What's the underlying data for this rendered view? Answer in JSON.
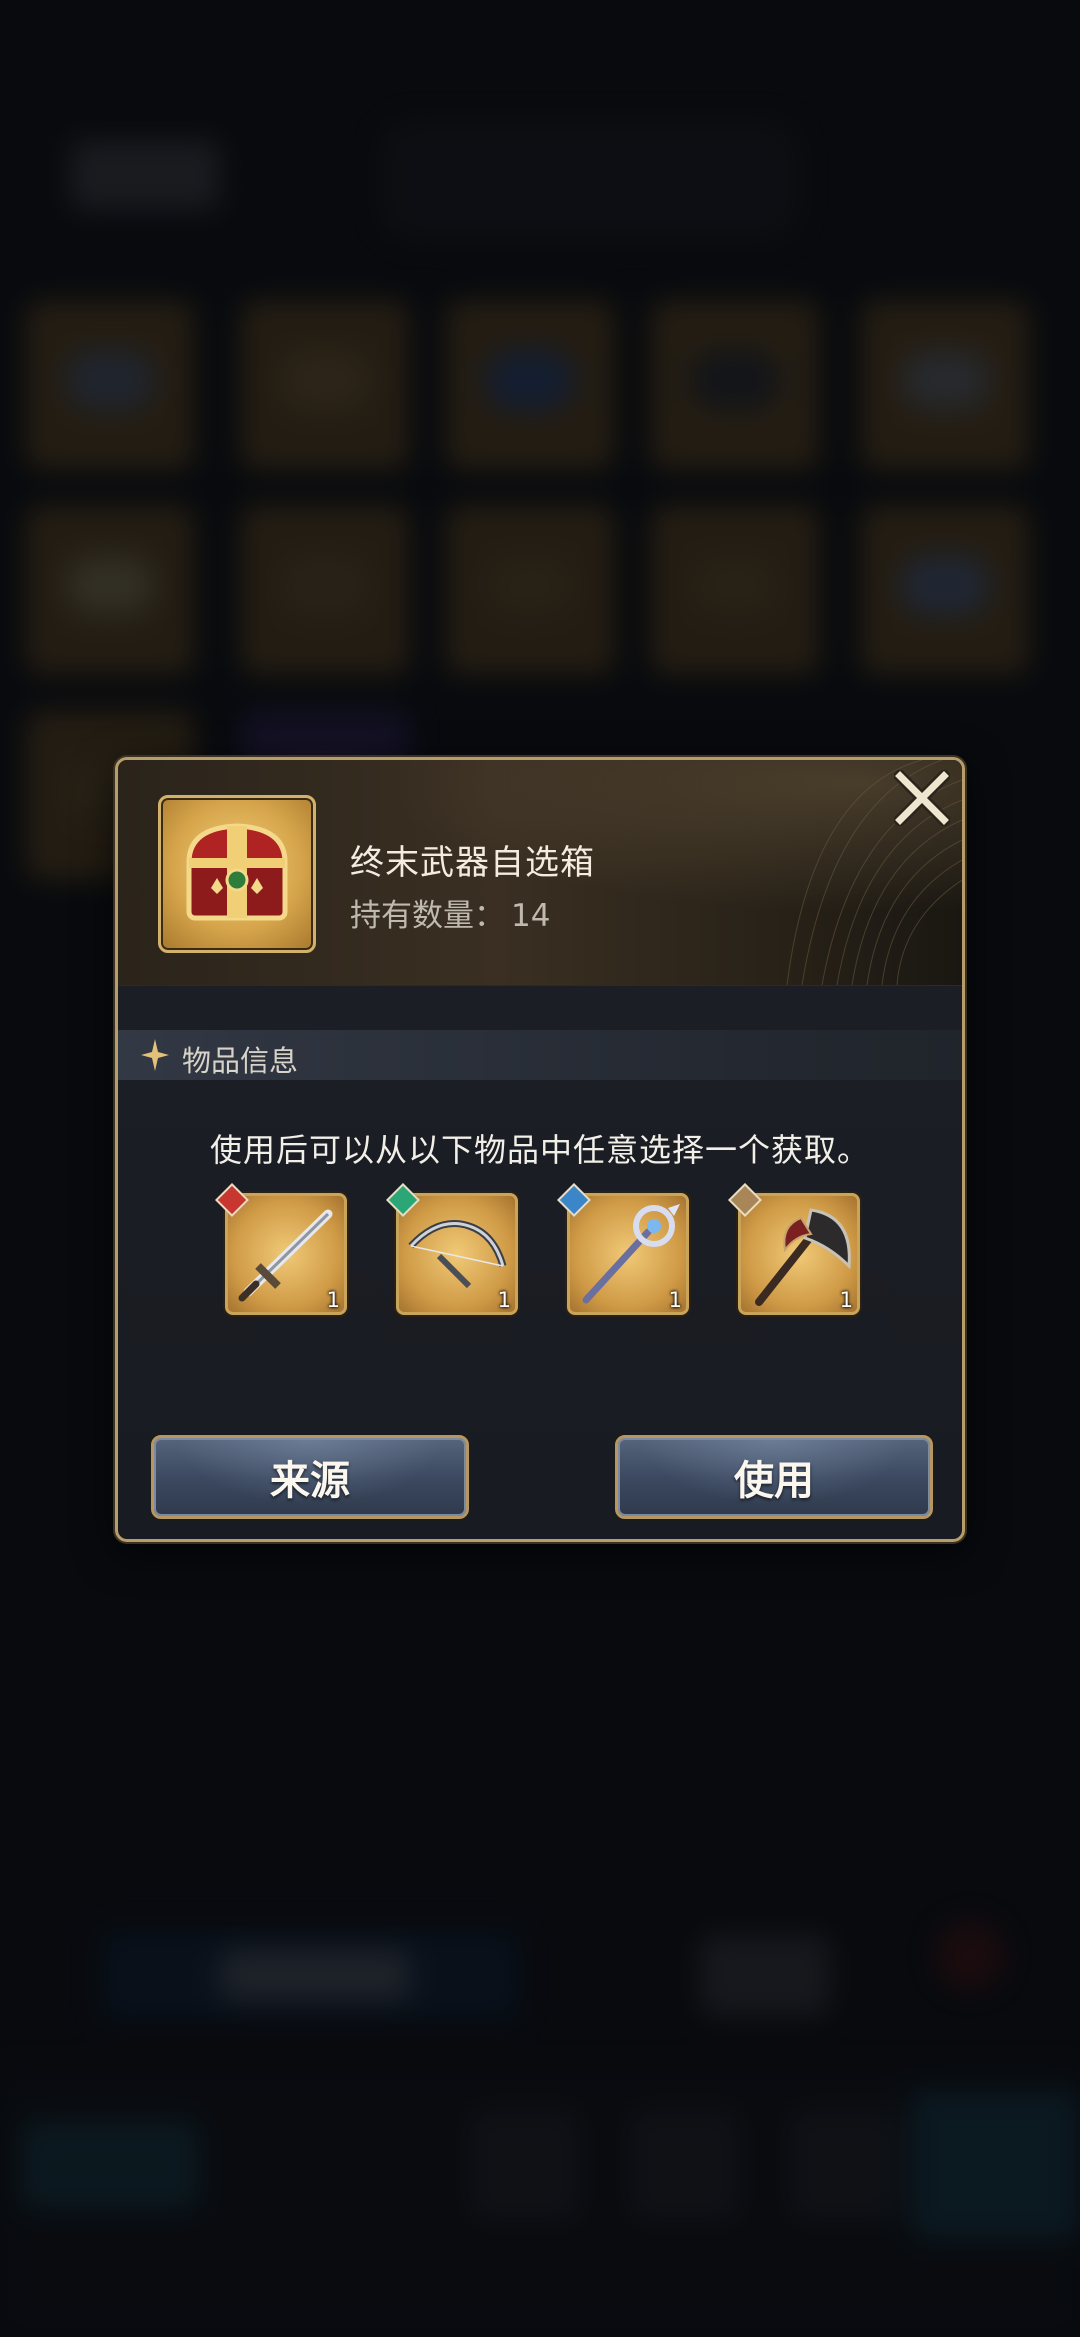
{
  "popup": {
    "item_name": "终末武器自选箱",
    "count_label": "持有数量：",
    "count_value": "14",
    "section_title": "物品信息",
    "description": "使用后可以从以下物品中任意选择一个获取。",
    "rewards": [
      {
        "icon": "greatsword-icon",
        "element": "fire",
        "element_color": "#c8372f",
        "quantity": "1"
      },
      {
        "icon": "bow-icon",
        "element": "wind",
        "element_color": "#2aa677",
        "quantity": "1"
      },
      {
        "icon": "staff-icon",
        "element": "water",
        "element_color": "#3a86c9",
        "quantity": "1"
      },
      {
        "icon": "axe-icon",
        "element": "earth",
        "element_color": "#a88657",
        "quantity": "1"
      }
    ],
    "buttons": {
      "source": "来源",
      "use": "使用"
    }
  },
  "colors": {
    "frame_gold": "#b79c6c",
    "button_blue": "#3c4960"
  }
}
